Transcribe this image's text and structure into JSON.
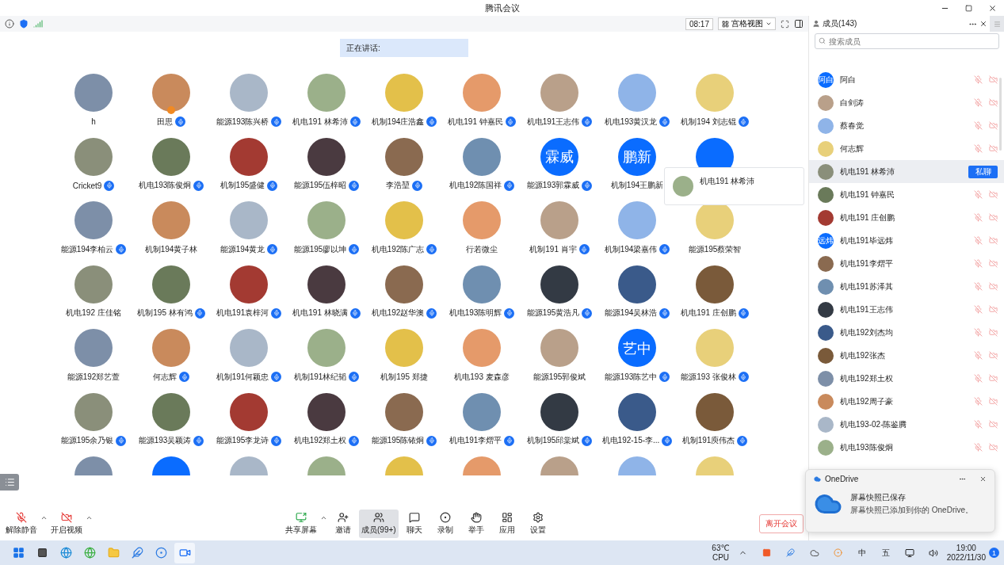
{
  "window": {
    "title": "腾讯会议"
  },
  "toolbar": {
    "time": "08:17",
    "view": "宫格视图"
  },
  "speaking": {
    "label": "正在讲话:"
  },
  "tiles": [
    {
      "name": "h",
      "kind": "photo",
      "mic": false,
      "host": false
    },
    {
      "name": "田思",
      "kind": "photo",
      "mic": true,
      "host": true
    },
    {
      "name": "能源193陈兴桥",
      "kind": "photo",
      "mic": true,
      "host": false
    },
    {
      "name": "机电191 林希沛",
      "kind": "photo",
      "mic": true,
      "host": false
    },
    {
      "name": "机制194庄浩鑫",
      "kind": "photo",
      "mic": true,
      "host": false
    },
    {
      "name": "机电191 钟嘉民",
      "kind": "photo",
      "mic": true,
      "host": false
    },
    {
      "name": "机电191王志伟",
      "kind": "photo",
      "mic": true,
      "host": false
    },
    {
      "name": "机电193黄汉龙",
      "kind": "photo",
      "mic": true,
      "host": false
    },
    {
      "name": "机制194 刘志锟",
      "kind": "photo",
      "mic": true,
      "host": false
    },
    {
      "name": "Cricket9",
      "kind": "photo",
      "mic": true,
      "host": false
    },
    {
      "name": "机电193陈俊炯",
      "kind": "photo",
      "mic": true,
      "host": false
    },
    {
      "name": "机制195盛健",
      "kind": "photo",
      "mic": true,
      "host": false
    },
    {
      "name": "能源195伍梓昭",
      "kind": "photo",
      "mic": true,
      "host": false
    },
    {
      "name": "李浩堃",
      "kind": "photo",
      "mic": true,
      "host": false
    },
    {
      "name": "机电192陈国祥",
      "kind": "photo",
      "mic": true,
      "host": false
    },
    {
      "name": "能源193郭霖威",
      "kind": "initials",
      "avatar_text": "霖威",
      "mic": true,
      "host": false
    },
    {
      "name": "机制194王鹏新",
      "kind": "initials",
      "avatar_text": "鹏新",
      "mic": false,
      "host": false
    },
    {
      "kind": "initials",
      "mic": false,
      "host": false
    },
    {
      "name": "能源194李柏云",
      "kind": "photo",
      "mic": true,
      "host": false
    },
    {
      "name": "机制194黄子林",
      "kind": "photo",
      "mic": false,
      "host": false
    },
    {
      "name": "能源194黄龙",
      "kind": "photo",
      "mic": true,
      "host": false
    },
    {
      "name": "能源195廖以坤",
      "kind": "photo",
      "mic": true,
      "host": false
    },
    {
      "name": "机电192陈广志",
      "kind": "photo",
      "mic": true,
      "host": false
    },
    {
      "name": "行若微尘",
      "kind": "photo",
      "mic": false,
      "host": false
    },
    {
      "name": "机制191 肖宇",
      "kind": "photo",
      "mic": true,
      "host": false
    },
    {
      "name": "机制194梁嘉伟",
      "kind": "photo",
      "mic": true,
      "host": false
    },
    {
      "name": "能源195蔡荣智",
      "kind": "photo",
      "mic": false,
      "host": false
    },
    {
      "name": "机电192 庄佳铭",
      "kind": "photo",
      "mic": false,
      "host": false
    },
    {
      "name": "机制195 林有鸿",
      "kind": "photo",
      "mic": true,
      "host": false
    },
    {
      "name": "机电191袁梓河",
      "kind": "photo",
      "mic": true,
      "host": false
    },
    {
      "name": "机电191 林晓满",
      "kind": "photo",
      "mic": true,
      "host": false
    },
    {
      "name": "机电192赵华澳",
      "kind": "photo",
      "mic": true,
      "host": false
    },
    {
      "name": "机电193陈明辉",
      "kind": "photo",
      "mic": true,
      "host": false
    },
    {
      "name": "能源195黄浩凡",
      "kind": "photo",
      "mic": true,
      "host": false
    },
    {
      "name": "能源194吴林浩",
      "kind": "photo",
      "mic": true,
      "host": false
    },
    {
      "name": "机电191 庄创鹏",
      "kind": "photo",
      "mic": true,
      "host": false
    },
    {
      "name": "能源192郑艺萱",
      "kind": "photo",
      "mic": false,
      "host": false
    },
    {
      "name": "何志辉",
      "kind": "photo",
      "mic": true,
      "host": false
    },
    {
      "name": "机制191何颖忠",
      "kind": "photo",
      "mic": true,
      "host": false
    },
    {
      "name": "机制191林纪韬",
      "kind": "photo",
      "mic": true,
      "host": false
    },
    {
      "name": "机制195 郑捷",
      "kind": "photo",
      "mic": false,
      "host": false
    },
    {
      "name": "机电193 麦森彦",
      "kind": "photo",
      "mic": false,
      "host": false
    },
    {
      "name": "能源195郭俊斌",
      "kind": "photo",
      "mic": false,
      "host": false
    },
    {
      "name": "能源193陈艺中",
      "kind": "initials",
      "avatar_text": "艺中",
      "mic": true,
      "host": false
    },
    {
      "name": "能源193 张俊林",
      "kind": "photo",
      "mic": true,
      "host": false
    },
    {
      "name": "能源195余乃银",
      "kind": "photo",
      "mic": true,
      "host": false
    },
    {
      "name": "能源193吴颖涛",
      "kind": "photo",
      "mic": true,
      "host": false
    },
    {
      "name": "能源195李龙诗",
      "kind": "photo",
      "mic": true,
      "host": false
    },
    {
      "name": "机电192郑土权",
      "kind": "photo",
      "mic": true,
      "host": false
    },
    {
      "name": "能源195陈铱炯",
      "kind": "photo",
      "mic": true,
      "host": false
    },
    {
      "name": "机电191李熠平",
      "kind": "photo",
      "mic": true,
      "host": false
    },
    {
      "name": "机制195邱棠斌",
      "kind": "photo",
      "mic": true,
      "host": false
    },
    {
      "name": "机电192-15-李...",
      "kind": "photo",
      "mic": true,
      "host": false
    },
    {
      "name": "机制191庾伟杰",
      "kind": "photo",
      "mic": true,
      "host": false
    },
    {
      "kind": "photo",
      "mic": false,
      "host": false
    },
    {
      "kind": "initials",
      "mic": false,
      "host": false
    },
    {
      "kind": "photo",
      "mic": false,
      "host": false
    },
    {
      "kind": "photo",
      "mic": false,
      "host": false
    },
    {
      "kind": "photo",
      "mic": false,
      "host": false
    },
    {
      "kind": "photo",
      "mic": false,
      "host": false
    },
    {
      "kind": "photo",
      "mic": false,
      "host": false
    },
    {
      "kind": "photo",
      "mic": false,
      "host": false
    },
    {
      "kind": "photo",
      "mic": false,
      "host": false
    }
  ],
  "hover_card": {
    "name": "机电191 林希沛"
  },
  "controls": [
    {
      "kind": "mic",
      "label": "解除静音",
      "menu": true,
      "selected": false
    },
    {
      "kind": "video",
      "label": "开启视频",
      "menu": true,
      "selected": false
    },
    {
      "kind": "share",
      "label": "共享屏幕",
      "menu": true,
      "selected": false
    },
    {
      "kind": "invite",
      "label": "邀请",
      "menu": false,
      "selected": false
    },
    {
      "kind": "members",
      "label": "成员(99+)",
      "menu": false,
      "selected": true
    },
    {
      "kind": "chat",
      "label": "聊天",
      "menu": false,
      "selected": false
    },
    {
      "kind": "record",
      "label": "录制",
      "menu": false,
      "selected": false
    },
    {
      "kind": "hand",
      "label": "举手",
      "menu": false,
      "selected": false
    },
    {
      "kind": "apps",
      "label": "应用",
      "menu": false,
      "selected": false
    },
    {
      "kind": "settings",
      "label": "设置",
      "menu": false,
      "selected": false
    }
  ],
  "leave_button": "离开会议",
  "sidebar": {
    "title": "成员(143)",
    "search": {
      "placeholder": "搜索成员"
    },
    "chat_button": "私聊",
    "members": [
      {
        "name": "阿白",
        "kind": "initials",
        "avatar_text": "阿白",
        "selected": false
      },
      {
        "name": "白剑涛",
        "kind": "photo",
        "selected": false
      },
      {
        "name": "蔡春觉",
        "kind": "photo",
        "selected": false
      },
      {
        "name": "何志辉",
        "kind": "photo",
        "selected": false
      },
      {
        "name": "机电191 林希沛",
        "kind": "photo",
        "selected": true
      },
      {
        "name": "机电191 钟嘉民",
        "kind": "photo",
        "selected": false
      },
      {
        "name": "机电191 庄创鹏",
        "kind": "photo",
        "selected": false
      },
      {
        "name": "机电191毕远炜",
        "kind": "initials",
        "avatar_text": "远炜",
        "selected": false
      },
      {
        "name": "机电191李熠平",
        "kind": "photo",
        "selected": false
      },
      {
        "name": "机电191苏泽其",
        "kind": "photo",
        "selected": false
      },
      {
        "name": "机电191王志伟",
        "kind": "photo",
        "selected": false
      },
      {
        "name": "机电192刘杰均",
        "kind": "photo",
        "selected": false
      },
      {
        "name": "机电192张杰",
        "kind": "photo",
        "selected": false
      },
      {
        "name": "机电192郑土权",
        "kind": "photo",
        "selected": false
      },
      {
        "name": "机电192周子豪",
        "kind": "photo",
        "selected": false
      },
      {
        "name": "机电193-02-陈鉴腾",
        "kind": "photo",
        "selected": false
      },
      {
        "name": "机电193陈俊炯",
        "kind": "photo",
        "selected": false
      }
    ]
  },
  "toast": {
    "app": "OneDrive",
    "title": "屏幕快照已保存",
    "message": "屏幕快照已添加到你的 OneDrive。"
  },
  "taskbar": {
    "temperature": "63℃",
    "sensor": "CPU",
    "ime": "中",
    "ime_mode": "五",
    "time": "19:00",
    "date": "2022/11/30",
    "notifications": "1"
  }
}
